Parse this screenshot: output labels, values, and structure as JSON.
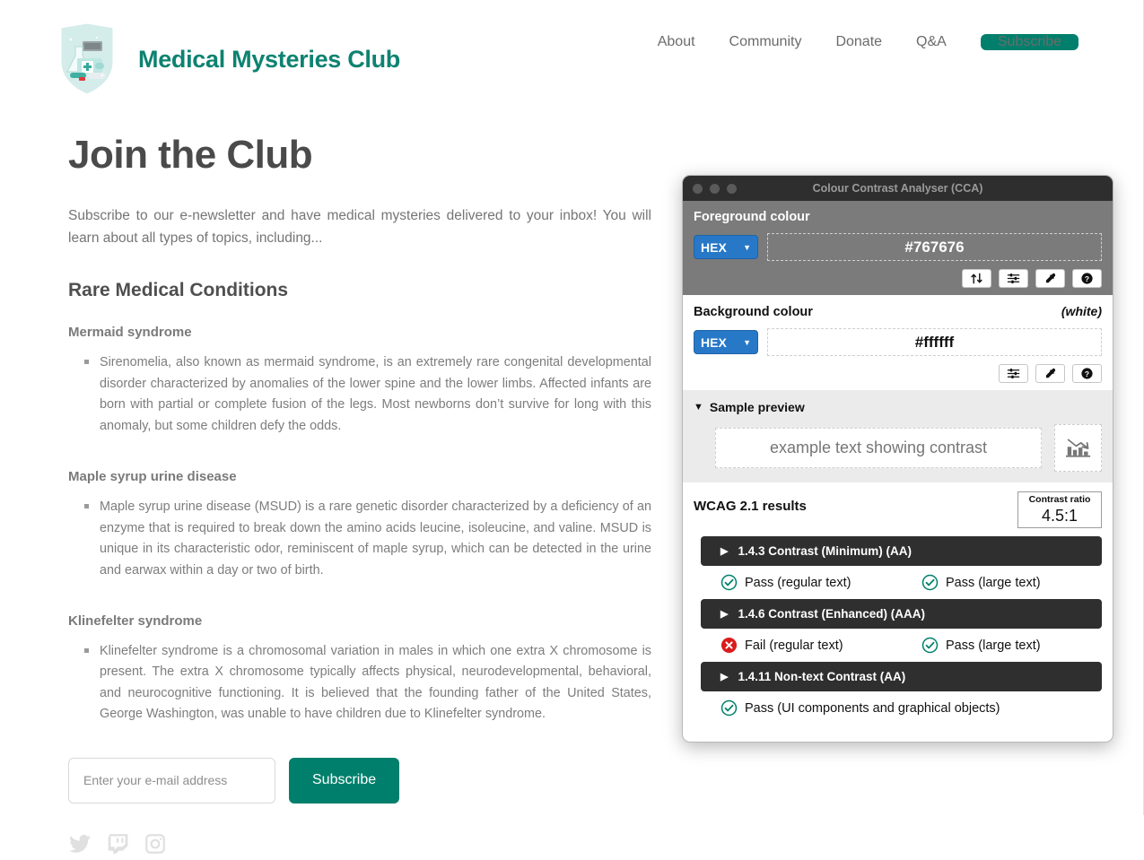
{
  "site": {
    "brand_title": "Medical Mysteries Club",
    "logo_icon": "medical-shield-logo",
    "nav_links": [
      {
        "label": "About"
      },
      {
        "label": "Community"
      },
      {
        "label": "Donate"
      },
      {
        "label": "Q&A"
      }
    ],
    "nav_cta_label": "Subscribe",
    "accent_color": "#00806c",
    "brand_color": "#0e8271"
  },
  "main": {
    "page_title": "Join the Club",
    "intro": "Subscribe to our e-newsletter and have medical mysteries delivered to your inbox! You will learn about all types of topics, including...",
    "section_title": "Rare Medical Conditions",
    "conditions": [
      {
        "title": "Mermaid syndrome",
        "body": "Sirenomelia, also known as mermaid syndrome, is an extremely rare congenital developmental disorder characterized by anomalies of the lower spine and the lower limbs. Affected infants are born with partial or complete fusion of the legs. Most newborns don’t survive for long with this anomaly, but some children defy the odds."
      },
      {
        "title": "Maple syrup urine disease",
        "body": "Maple syrup urine disease (MSUD) is a rare genetic disorder characterized by a deficiency of an enzyme that is required to break down the amino acids leucine, isoleucine, and valine. MSUD is unique in its characteristic odor, reminiscent of maple syrup, which can be detected in the urine and earwax within a day or two of birth."
      },
      {
        "title": "Klinefelter syndrome",
        "body": "Klinefelter syndrome is a chromosomal variation in males in which one extra X chromosome is present. The extra X chromosome typically affects physical, neurodevelopmental, behavioral, and neurocognitive functioning. It is believed that the founding father of the United States, George Washington, was unable to have children due to Klinefelter syndrome."
      }
    ],
    "form": {
      "email_placeholder": "Enter your e-mail address",
      "email_value": "",
      "submit_label": "Subscribe"
    },
    "social": [
      {
        "name": "twitter-icon"
      },
      {
        "name": "twitch-icon"
      },
      {
        "name": "instagram-icon"
      }
    ]
  },
  "cca": {
    "window_title": "Colour Contrast Analyser (CCA)",
    "traffic_lights": [
      "close",
      "minimize",
      "maximize"
    ],
    "foreground": {
      "label": "Foreground colour",
      "format": "HEX",
      "value": "#767676",
      "buttons": [
        {
          "name": "swap-colours-icon"
        },
        {
          "name": "sliders-icon"
        },
        {
          "name": "eyedropper-icon"
        },
        {
          "name": "help-icon"
        }
      ]
    },
    "background": {
      "label": "Background colour",
      "note": "(white)",
      "format": "HEX",
      "value": "#ffffff",
      "buttons": [
        {
          "name": "sliders-icon"
        },
        {
          "name": "eyedropper-icon"
        },
        {
          "name": "help-icon"
        }
      ]
    },
    "sample_preview": {
      "label": "Sample preview",
      "expanded": true,
      "text": "example text showing contrast",
      "graphic_icon": "bar-chart-declining-icon"
    },
    "results": {
      "title": "WCAG 2.1 results",
      "ratio_label": "Contrast ratio",
      "ratio_value": "4.5:1",
      "criteria": [
        {
          "name": "1.4.3 Contrast (Minimum) (AA)",
          "outcomes": [
            {
              "status": "pass",
              "label": "Pass (regular text)"
            },
            {
              "status": "pass",
              "label": "Pass (large text)"
            }
          ]
        },
        {
          "name": "1.4.6 Contrast (Enhanced) (AAA)",
          "outcomes": [
            {
              "status": "fail",
              "label": "Fail (regular text)"
            },
            {
              "status": "pass",
              "label": "Pass (large text)"
            }
          ]
        },
        {
          "name": "1.4.11 Non-text Contrast (AA)",
          "outcomes": [
            {
              "status": "pass",
              "label": "Pass (UI components and graphical objects)"
            }
          ]
        }
      ]
    },
    "colors": {
      "pass": "#00806c",
      "fail": "#d91c1c",
      "titlebar": "#2e2e2e",
      "select": "#2878c8"
    }
  }
}
